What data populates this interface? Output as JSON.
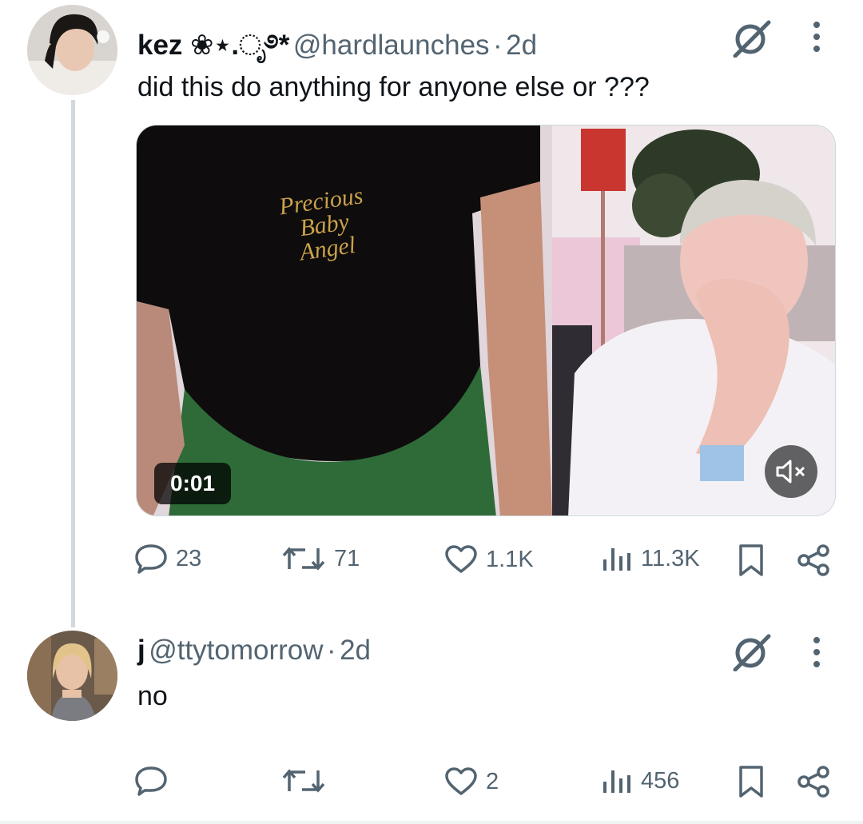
{
  "post": {
    "display_name": "kez ❀⋆.ೃ࿔*",
    "handle": "@hardlaunches",
    "separator": "·",
    "time": "2d",
    "text": "did this do anything for anyone else or ???",
    "video": {
      "timecode": "0:01",
      "shirt_text": [
        "Precious",
        "Baby",
        "Angel"
      ]
    },
    "actions": {
      "replies": "23",
      "reposts": "71",
      "likes": "1.1K",
      "views": "11.3K"
    }
  },
  "reply": {
    "display_name": "j",
    "handle": "@ttytomorrow",
    "separator": "·",
    "time": "2d",
    "text": "no",
    "actions": {
      "replies": "",
      "reposts": "",
      "likes": "2",
      "views": "456"
    }
  },
  "colors": {
    "text_primary": "#0f1419",
    "text_secondary": "#536471",
    "thread_line": "#cfd9de"
  }
}
